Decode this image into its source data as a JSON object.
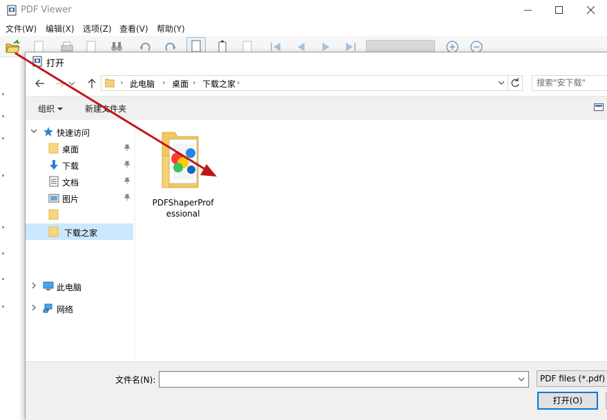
{
  "app": {
    "title": "PDF Viewer",
    "menu": [
      "文件(W)",
      "编辑(X)",
      "选项(Z)",
      "查看(V)",
      "帮助(Y)"
    ],
    "toolbar_icons": [
      "open-folder-icon",
      "page-icon",
      "print-icon",
      "page-setup-icon",
      "binoculars-icon",
      "rotate-left-icon",
      "rotate-right-icon",
      "fit-page-icon",
      "fit-width-icon",
      "page-icon",
      "first-page-icon",
      "previous-page-icon",
      "next-page-icon",
      "last-page-icon",
      "zoom-in-icon",
      "zoom-out-icon"
    ]
  },
  "dialog": {
    "title": "打开",
    "breadcrumb": [
      "此电脑",
      "桌面",
      "下载之家"
    ],
    "search_placeholder": "搜索\"安下载\"",
    "commands": {
      "organize": "组织",
      "new_folder": "新建文件夹"
    },
    "nav": {
      "quick_access": "快速访问",
      "pinned": [
        {
          "label": "桌面",
          "icon": "folder-icon"
        },
        {
          "label": "下载",
          "icon": "download-arrow-icon"
        },
        {
          "label": "文档",
          "icon": "document-icon"
        },
        {
          "label": "图片",
          "icon": "pictures-icon"
        }
      ],
      "unnamed_folder": "",
      "selected_folder": "下载之家",
      "this_pc": "此电脑",
      "network": "网络"
    },
    "files": [
      {
        "name": "PDFShaperProfessional",
        "type": "folder"
      }
    ],
    "filename_label": "文件名(N):",
    "filename_value": "",
    "filetype": "PDF files (*.pdf)",
    "open_button": "打开(O)"
  },
  "colors": {
    "accent": "#0078d7",
    "selection": "#cce8ff",
    "annotation_arrow": "#c0151b"
  }
}
